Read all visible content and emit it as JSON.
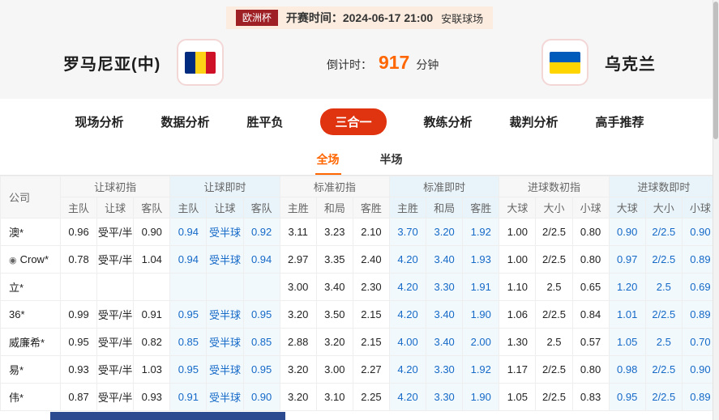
{
  "header": {
    "league_badge": "欧洲杯",
    "kickoff": "开赛时间：2024-06-17 21:00",
    "venue": "安联球场",
    "home_team": "罗马尼亚(中)",
    "away_team": "乌克兰",
    "countdown_label": "倒计时：",
    "countdown_value": "917",
    "countdown_unit": "分钟",
    "badge_color": "#9e1f24",
    "countdown_color": "#ff6600"
  },
  "nav": {
    "items": [
      "现场分析",
      "数据分析",
      "胜平负",
      "三合一",
      "教练分析",
      "裁判分析",
      "高手推荐"
    ],
    "active_index": 3,
    "active_color": "#e0330f"
  },
  "subtabs": {
    "items": [
      "全场",
      "半场"
    ],
    "active_index": 0,
    "active_color": "#ff6600"
  },
  "flags": {
    "romania": [
      "#002B7F",
      "#FCD116",
      "#CE1126"
    ],
    "ukraine": [
      "#005BBB",
      "#FFD500"
    ]
  },
  "odds_table": {
    "company_header": "公司",
    "live_text_color": "#1569c7",
    "groups": [
      {
        "label": "让球初指",
        "live": false,
        "cols": [
          "主队",
          "让球",
          "客队"
        ]
      },
      {
        "label": "让球即时",
        "live": true,
        "cols": [
          "主队",
          "让球",
          "客队"
        ]
      },
      {
        "label": "标准初指",
        "live": false,
        "cols": [
          "主胜",
          "和局",
          "客胜"
        ]
      },
      {
        "label": "标准即时",
        "live": true,
        "cols": [
          "主胜",
          "和局",
          "客胜"
        ]
      },
      {
        "label": "进球数初指",
        "live": false,
        "cols": [
          "大球",
          "大小",
          "小球"
        ]
      },
      {
        "label": "进球数即时",
        "live": true,
        "cols": [
          "大球",
          "大小",
          "小球"
        ]
      }
    ],
    "rows": [
      {
        "company": "澳*",
        "icon": false,
        "cells": [
          [
            "0.96",
            "受平/半",
            "0.90"
          ],
          [
            "0.94",
            "受半球",
            "0.92"
          ],
          [
            "3.11",
            "3.23",
            "2.10"
          ],
          [
            "3.70",
            "3.20",
            "1.92"
          ],
          [
            "1.00",
            "2/2.5",
            "0.80"
          ],
          [
            "0.90",
            "2/2.5",
            "0.90"
          ]
        ]
      },
      {
        "company": "Crow*",
        "icon": true,
        "cells": [
          [
            "0.78",
            "受平/半",
            "1.04"
          ],
          [
            "0.94",
            "受半球",
            "0.94"
          ],
          [
            "2.97",
            "3.35",
            "2.40"
          ],
          [
            "4.20",
            "3.40",
            "1.93"
          ],
          [
            "1.00",
            "2/2.5",
            "0.80"
          ],
          [
            "0.97",
            "2/2.5",
            "0.89"
          ]
        ]
      },
      {
        "company": "立*",
        "icon": false,
        "cells": [
          [
            "",
            "",
            ""
          ],
          [
            "",
            "",
            ""
          ],
          [
            "3.00",
            "3.40",
            "2.30"
          ],
          [
            "4.20",
            "3.30",
            "1.91"
          ],
          [
            "1.10",
            "2.5",
            "0.65"
          ],
          [
            "1.20",
            "2.5",
            "0.69"
          ]
        ]
      },
      {
        "company": "36*",
        "icon": false,
        "cells": [
          [
            "0.99",
            "受平/半",
            "0.91"
          ],
          [
            "0.95",
            "受半球",
            "0.95"
          ],
          [
            "3.20",
            "3.50",
            "2.15"
          ],
          [
            "4.20",
            "3.40",
            "1.90"
          ],
          [
            "1.06",
            "2/2.5",
            "0.84"
          ],
          [
            "1.01",
            "2/2.5",
            "0.89"
          ]
        ]
      },
      {
        "company": "威廉希*",
        "icon": false,
        "cells": [
          [
            "0.95",
            "受平/半",
            "0.82"
          ],
          [
            "0.85",
            "受半球",
            "0.85"
          ],
          [
            "2.88",
            "3.20",
            "2.15"
          ],
          [
            "4.00",
            "3.40",
            "2.00"
          ],
          [
            "1.30",
            "2.5",
            "0.57"
          ],
          [
            "1.05",
            "2.5",
            "0.70"
          ]
        ]
      },
      {
        "company": "易*",
        "icon": false,
        "cells": [
          [
            "0.93",
            "受平/半",
            "1.03"
          ],
          [
            "0.95",
            "受半球",
            "0.95"
          ],
          [
            "3.20",
            "3.00",
            "2.27"
          ],
          [
            "4.20",
            "3.30",
            "1.92"
          ],
          [
            "1.17",
            "2/2.5",
            "0.80"
          ],
          [
            "0.98",
            "2/2.5",
            "0.90"
          ]
        ]
      },
      {
        "company": "伟*",
        "icon": false,
        "cells": [
          [
            "0.87",
            "受平/半",
            "0.93"
          ],
          [
            "0.91",
            "受半球",
            "0.90"
          ],
          [
            "3.20",
            "3.10",
            "2.25"
          ],
          [
            "4.20",
            "3.30",
            "1.90"
          ],
          [
            "1.05",
            "2/2.5",
            "0.83"
          ],
          [
            "0.95",
            "2/2.5",
            "0.89"
          ]
        ]
      }
    ]
  }
}
